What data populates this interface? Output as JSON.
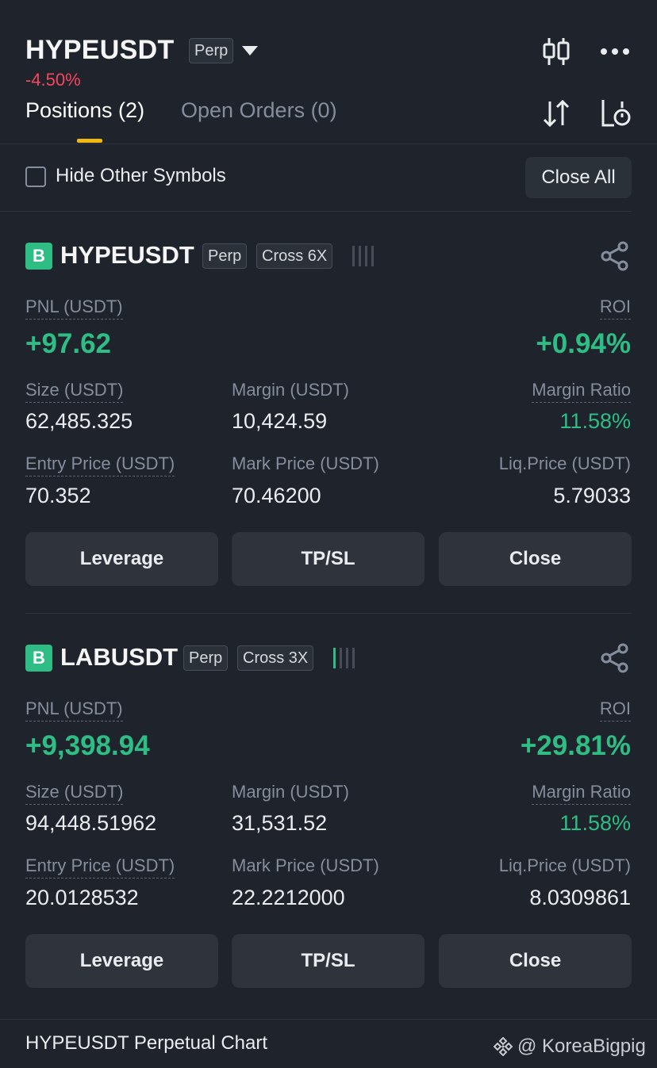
{
  "header": {
    "symbol": "HYPEUSDT",
    "contract_type": "Perp",
    "change": "-4.50%",
    "icons": [
      "candlestick-chart-icon",
      "more-icon",
      "sort-icon",
      "history-icon"
    ]
  },
  "tabs": [
    {
      "label": "Positions (2)",
      "active": true
    },
    {
      "label": "Open Orders (0)",
      "active": false
    }
  ],
  "filter": {
    "hide_other_symbols_label": "Hide Other Symbols",
    "hide_other_symbols_checked": false,
    "close_all_label": "Close All"
  },
  "positions": [
    {
      "side": "B",
      "symbol": "HYPEUSDT",
      "type": "Perp",
      "margin_mode": "Cross 6X",
      "pnl_label": "PNL (USDT)",
      "pnl": "+97.62",
      "roi_label": "ROI",
      "roi": "+0.94%",
      "size_label": "Size (USDT)",
      "size": "62,485.325",
      "margin_label": "Margin (USDT)",
      "margin": "10,424.59",
      "margin_ratio_label": "Margin Ratio",
      "margin_ratio": "11.58%",
      "entry_price_label": "Entry Price (USDT)",
      "entry_price": "70.352",
      "mark_price_label": "Mark Price (USDT)",
      "mark_price": "70.46200",
      "liq_price_label": "Liq.Price (USDT)",
      "liq_price": "5.79033",
      "risk_bars_active": 0,
      "buttons": {
        "leverage": "Leverage",
        "tpsl": "TP/SL",
        "close": "Close"
      }
    },
    {
      "side": "B",
      "symbol": "LABUSDT",
      "type": "Perp",
      "margin_mode": "Cross 3X",
      "pnl_label": "PNL (USDT)",
      "pnl": "+9,398.94",
      "roi_label": "ROI",
      "roi": "+29.81%",
      "size_label": "Size (USDT)",
      "size": "94,448.51962",
      "margin_label": "Margin (USDT)",
      "margin": "31,531.52",
      "margin_ratio_label": "Margin Ratio",
      "margin_ratio": "11.58%",
      "entry_price_label": "Entry Price (USDT)",
      "entry_price": "20.0128532",
      "mark_price_label": "Mark Price (USDT)",
      "mark_price": "22.2212000",
      "liq_price_label": "Liq.Price (USDT)",
      "liq_price": "8.0309861",
      "risk_bars_active": 1,
      "buttons": {
        "leverage": "Leverage",
        "tpsl": "TP/SL",
        "close": "Close"
      }
    }
  ],
  "footer": {
    "chart_link": "HYPEUSDT Perpetual Chart",
    "watermark": "@ KoreaBigpig"
  },
  "colors": {
    "background": "#1f232b",
    "positive": "#2ebd85",
    "negative": "#f6465d",
    "accent": "#f0b90b"
  }
}
